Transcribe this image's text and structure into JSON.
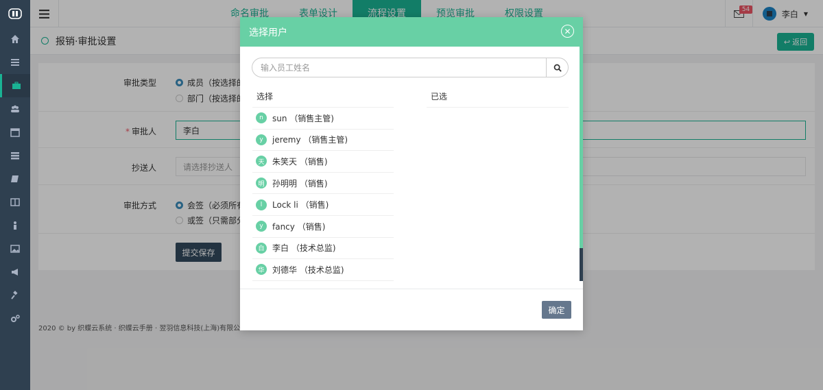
{
  "topbar": {
    "tabs": [
      {
        "label": "命名审批",
        "active": false
      },
      {
        "label": "表单设计",
        "active": false
      },
      {
        "label": "流程设置",
        "active": true
      },
      {
        "label": "预览审批",
        "active": false
      },
      {
        "label": "权限设置",
        "active": false
      }
    ],
    "mail_count": "54",
    "user_name": "李白"
  },
  "page": {
    "title": "报销·审批设置",
    "back_label": "返回"
  },
  "form": {
    "type_label": "审批类型",
    "type_option_member": "成员（按选择的",
    "type_option_dept": "部门（按选择的",
    "approver_label": "审批人",
    "approver_value": "李白",
    "cc_label": "抄送人",
    "cc_placeholder": "请选择抄送人",
    "method_label": "审批方式",
    "method_option_all": "会签（必须所有",
    "method_option_any": "或签（只需部分",
    "submit_label": "提交保存"
  },
  "footer": {
    "text": "2020 © by 织蝶云系统 · 织蝶云手册 · 翌羽信息科技(上海)有限公"
  },
  "modal": {
    "title": "选择用户",
    "search_placeholder": "输入员工姓名",
    "select_header": "选择",
    "selected_header": "已选",
    "confirm_label": "确定",
    "users": [
      {
        "initial": "n",
        "name": "sun （销售主管)"
      },
      {
        "initial": "y",
        "name": "jeremy （销售主管)"
      },
      {
        "initial": "天",
        "name": "朱笑天 （销售)"
      },
      {
        "initial": "明",
        "name": "孙明明 （销售)"
      },
      {
        "initial": "l",
        "name": "Lock li （销售)"
      },
      {
        "initial": "y",
        "name": "fancy （销售)"
      },
      {
        "initial": "白",
        "name": "李白 （技术总监)"
      },
      {
        "initial": "华",
        "name": "刘德华 （技术总监)"
      }
    ]
  },
  "colors": {
    "accent": "#1ab394",
    "modal_header": "#68d0a5",
    "sidebar": "#2f4050",
    "submit": "#334a5e",
    "confirm": "#65778d"
  }
}
